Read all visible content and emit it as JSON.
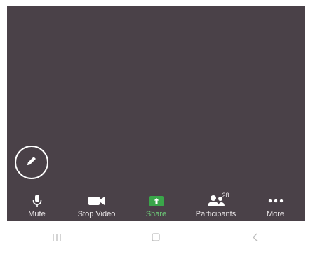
{
  "toolbar": {
    "mute_label": "Mute",
    "stop_video_label": "Stop Video",
    "share_label": "Share",
    "participants_label": "Participants",
    "participants_count": "28",
    "more_label": "More"
  },
  "colors": {
    "background": "#4a4148",
    "share_accent": "#3aa64a",
    "label_text": "#e8e4e6"
  },
  "icons": {
    "annotate": "pencil-icon",
    "mute": "microphone-icon",
    "video": "video-camera-icon",
    "share": "share-arrow-icon",
    "participants": "people-icon",
    "more": "more-dots-icon",
    "nav_recent": "recent-apps-icon",
    "nav_home": "home-icon",
    "nav_back": "back-icon"
  }
}
